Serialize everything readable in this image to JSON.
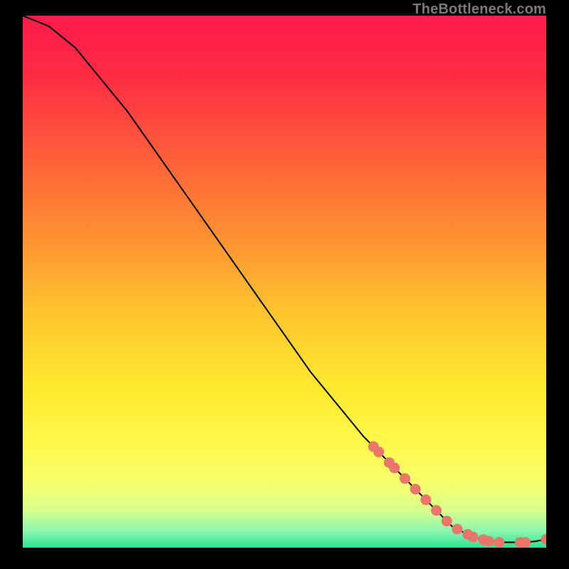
{
  "watermark": "TheBottleneck.com",
  "chart_data": {
    "type": "line",
    "title": "",
    "xlabel": "",
    "ylabel": "",
    "xlim": [
      0,
      100
    ],
    "ylim": [
      0,
      100
    ],
    "grid": false,
    "curve": {
      "name": "bottleneck-curve",
      "x": [
        0,
        5,
        10,
        15,
        20,
        25,
        30,
        35,
        40,
        45,
        50,
        55,
        60,
        65,
        70,
        75,
        80,
        82,
        84,
        86,
        88,
        90,
        92,
        94,
        96,
        98,
        100
      ],
      "y": [
        100,
        98,
        94,
        88,
        82,
        75,
        68,
        61,
        54,
        47,
        40,
        33,
        27,
        21,
        16,
        11,
        6,
        4,
        3,
        2,
        1.5,
        1.2,
        1.0,
        1.0,
        1.0,
        1.2,
        1.6
      ]
    },
    "markers": {
      "name": "highlight-points",
      "x": [
        67,
        68,
        70,
        71,
        73,
        75,
        77,
        79,
        81,
        83,
        85,
        86,
        88,
        89,
        91,
        95,
        96,
        100
      ],
      "y": [
        19,
        18,
        16,
        15,
        13,
        11,
        9,
        7,
        5,
        3.5,
        2.5,
        2,
        1.5,
        1.2,
        1.0,
        1.0,
        1.0,
        1.6
      ]
    },
    "background_gradient": {
      "stops": [
        {
          "offset": 0.0,
          "color": "#ff1a4b"
        },
        {
          "offset": 0.12,
          "color": "#ff2d44"
        },
        {
          "offset": 0.25,
          "color": "#ff5a3a"
        },
        {
          "offset": 0.4,
          "color": "#ff8b33"
        },
        {
          "offset": 0.55,
          "color": "#ffc22e"
        },
        {
          "offset": 0.7,
          "color": "#ffe92e"
        },
        {
          "offset": 0.8,
          "color": "#fff84a"
        },
        {
          "offset": 0.88,
          "color": "#f7ff6d"
        },
        {
          "offset": 0.93,
          "color": "#d8ff8c"
        },
        {
          "offset": 0.97,
          "color": "#88f7b0"
        },
        {
          "offset": 1.0,
          "color": "#27e38f"
        }
      ]
    },
    "marker_style": {
      "fill": "#e8766a",
      "stroke": "#e8766a",
      "r": 7
    },
    "line_style": {
      "stroke": "#000000",
      "width": 2
    }
  }
}
